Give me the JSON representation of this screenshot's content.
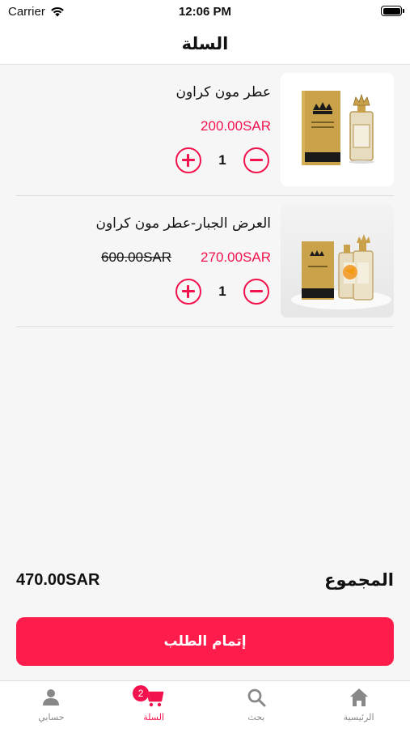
{
  "status_bar": {
    "carrier": "Carrier",
    "time": "12:06 PM"
  },
  "nav": {
    "title": "السلة"
  },
  "cart_items": [
    {
      "name": "عطر مون كراون",
      "price": "200.00SAR",
      "old_price": "",
      "quantity": "1"
    },
    {
      "name": "العرض الجبار-عطر مون كراون",
      "price": "270.00SAR",
      "old_price": "600.00SAR",
      "quantity": "1"
    }
  ],
  "summary": {
    "total_label": "المجموع",
    "total_value": "470.00SAR"
  },
  "checkout": {
    "label": "إتمام الطلب"
  },
  "tab_bar": {
    "tabs": [
      {
        "label": "حسابي",
        "icon": "person-icon"
      },
      {
        "label": "السلة",
        "icon": "cart-icon",
        "badge": "2",
        "active": true
      },
      {
        "label": "بحث",
        "icon": "search-icon"
      },
      {
        "label": "الرئيسية",
        "icon": "home-icon"
      }
    ]
  },
  "colors": {
    "accent": "#f2134e",
    "button": "#fe1c4c",
    "background": "#f6f6f6"
  }
}
